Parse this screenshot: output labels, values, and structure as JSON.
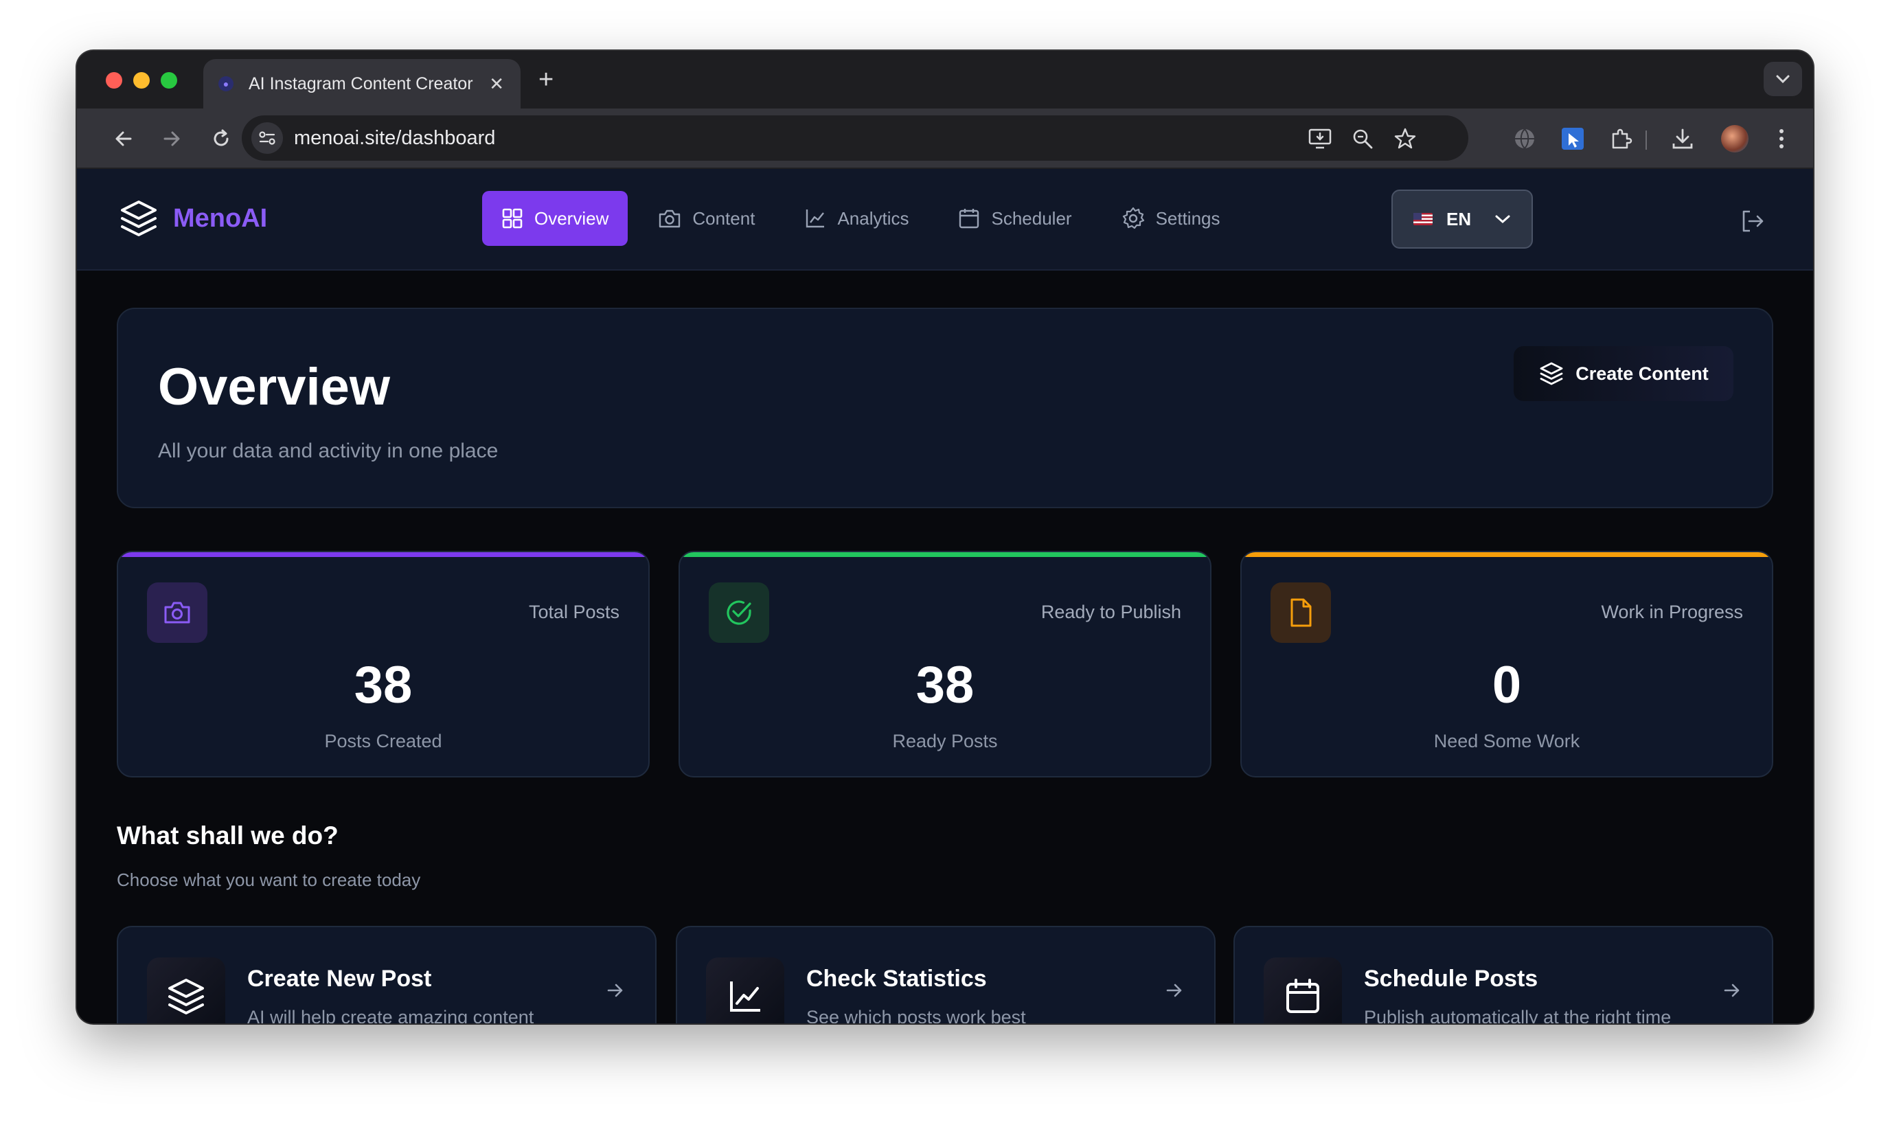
{
  "browser": {
    "tab_title": "AI Instagram Content Creator",
    "tab_close": "✕",
    "new_tab": "+",
    "url": "menoai.site/dashboard"
  },
  "nav": {
    "brand": "MenoAI",
    "links": [
      "Overview",
      "Content",
      "Analytics",
      "Scheduler",
      "Settings"
    ],
    "active": "Overview",
    "language": "EN"
  },
  "hero": {
    "title": "Overview",
    "subtitle": "All your data and activity in one place",
    "create_button": "Create Content"
  },
  "stats": [
    {
      "label": "Total Posts",
      "value": "38",
      "sub": "Posts Created",
      "accent": "#7c3aed"
    },
    {
      "label": "Ready to Publish",
      "value": "38",
      "sub": "Ready Posts",
      "accent": "#22c55e"
    },
    {
      "label": "Work in Progress",
      "value": "0",
      "sub": "Need Some Work",
      "accent": "#f59e0b"
    }
  ],
  "section": {
    "title": "What shall we do?",
    "subtitle": "Choose what you want to create today"
  },
  "actions": [
    {
      "title": "Create New Post",
      "subtitle": "AI will help create amazing content"
    },
    {
      "title": "Check Statistics",
      "subtitle": "See which posts work best"
    },
    {
      "title": "Schedule Posts",
      "subtitle": "Publish automatically at the right time"
    }
  ],
  "colors": {
    "brand": "#8b5cf6",
    "active_nav": "#7c3aed",
    "card": "#0f1729",
    "background": "#08090d"
  }
}
